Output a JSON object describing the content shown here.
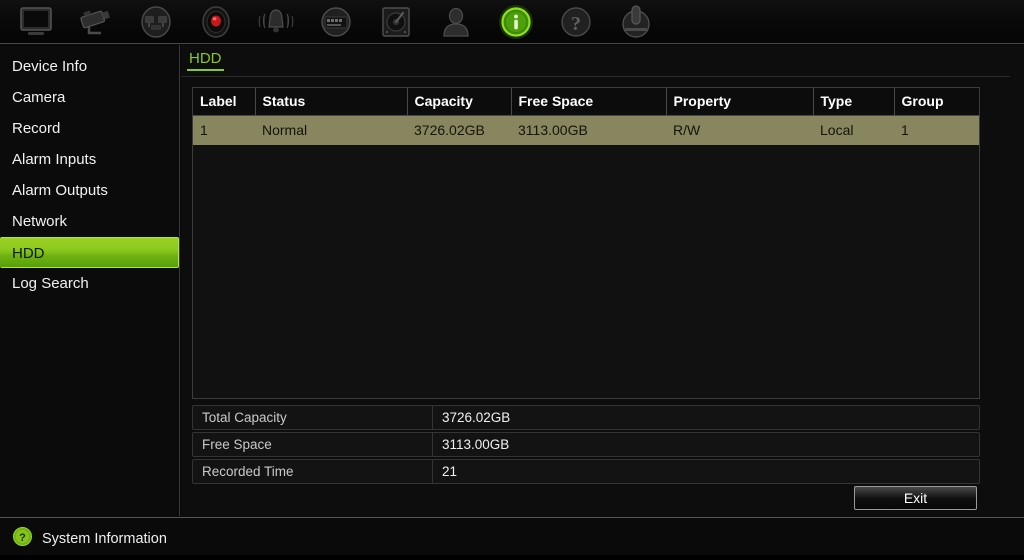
{
  "toolbar": {
    "items": [
      {
        "name": "monitor-icon",
        "label": "Display",
        "active": false
      },
      {
        "name": "camera-icon",
        "label": "Camera",
        "active": false
      },
      {
        "name": "network-icon",
        "label": "Network",
        "active": false
      },
      {
        "name": "record-icon",
        "label": "Record",
        "active": false
      },
      {
        "name": "alarm-icon",
        "label": "Alarm",
        "active": false
      },
      {
        "name": "device-icon",
        "label": "Device",
        "active": false
      },
      {
        "name": "hdd-icon",
        "label": "HDD",
        "active": false
      },
      {
        "name": "user-icon",
        "label": "User",
        "active": false
      },
      {
        "name": "info-icon",
        "label": "System Info",
        "active": true
      },
      {
        "name": "help-icon",
        "label": "Help",
        "active": false
      },
      {
        "name": "power-icon",
        "label": "Shutdown",
        "active": false
      }
    ]
  },
  "sidebar": {
    "items": [
      {
        "label": "Device Info",
        "selected": false
      },
      {
        "label": "Camera",
        "selected": false
      },
      {
        "label": "Record",
        "selected": false
      },
      {
        "label": "Alarm Inputs",
        "selected": false
      },
      {
        "label": "Alarm Outputs",
        "selected": false
      },
      {
        "label": "Network",
        "selected": false
      },
      {
        "label": "HDD",
        "selected": true
      },
      {
        "label": "Log Search",
        "selected": false
      }
    ]
  },
  "main": {
    "tab_label": "HDD",
    "table": {
      "columns": [
        "Label",
        "Status",
        "Capacity",
        "Free Space",
        "Property",
        "Type",
        "Group"
      ],
      "rows": [
        {
          "selected": true,
          "cells": [
            "1",
            "Normal",
            "3726.02GB",
            "3113.00GB",
            "R/W",
            "Local",
            "1"
          ]
        }
      ]
    },
    "summary": [
      {
        "key": "Total Capacity",
        "value": "3726.02GB"
      },
      {
        "key": "Free Space",
        "value": "3113.00GB"
      },
      {
        "key": "Recorded Time",
        "value": "21"
      }
    ],
    "exit_label": "Exit"
  },
  "statusbar": {
    "icon": "help-circle-icon",
    "text": "System Information"
  },
  "colors": {
    "accent_green": "#8cc81e",
    "selected_row": "#87865e",
    "panel_bg": "#0d0d0d",
    "sidebar_bg": "#0b0b0b",
    "text": "#f0f0f0"
  }
}
